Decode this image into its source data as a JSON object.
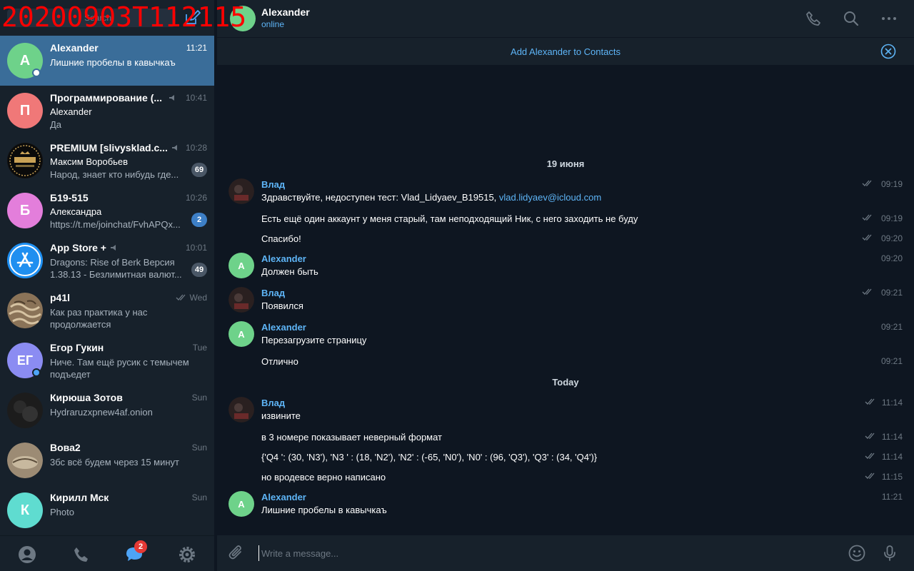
{
  "watermark": "20200903T112115",
  "search": {
    "placeholder": "Search"
  },
  "chats": [
    {
      "initial": "A",
      "name": "Alexander",
      "time": "11:21",
      "preview": "Лишние пробелы в кавычкаъ",
      "color": "#6ed28a",
      "online": true,
      "active": true
    },
    {
      "initial": "П",
      "name": "Программирование (...",
      "time": "10:41",
      "sender": "Alexander",
      "preview": "Да",
      "color": "#f07878",
      "muted": true
    },
    {
      "initial": "",
      "name": "PREMIUM [slivysklad.c...",
      "time": "10:28",
      "sender": "Максим Воробьев",
      "preview": "Народ, знает кто нибудь где...",
      "badge": "69",
      "muted": true,
      "avatar_image": "premium-logo"
    },
    {
      "initial": "Б",
      "name": "Б19-515",
      "time": "10:26",
      "sender": "Александра",
      "preview": "https://t.me/joinchat/FvhAPQx...",
      "badge": "2",
      "badge_color": "blue",
      "color": "#e37edb"
    },
    {
      "initial": "",
      "name": "App Store +",
      "time": "10:01",
      "preview": "Dragons: Rise of Berk Версия 1.38.13 - Безлимитная валют...",
      "badge": "49",
      "muted": true,
      "avatar_image": "app-store-logo"
    },
    {
      "initial": "",
      "name": "p41l",
      "time": "Wed",
      "preview": "Как раз практика у нас продолжается",
      "read": true,
      "avatar_image": "photo-pasta"
    },
    {
      "initial": "ЕГ",
      "name": "Егор Гукин",
      "time": "Tue",
      "preview": "Ниче. Там ещё русик с темычем подъедет",
      "color": "#8b8cf2",
      "online": true
    },
    {
      "initial": "",
      "name": "Кирюша Зотов",
      "time": "Sun",
      "preview": "Hydraruzxpnew4af.onion",
      "avatar_image": "photo-dark"
    },
    {
      "initial": "",
      "name": "Вова2",
      "time": "Sun",
      "preview": "3бс всё будем через 15 минут",
      "avatar_image": "photo-fish"
    },
    {
      "initial": "К",
      "name": "Кирилл Мск",
      "time": "Sun",
      "preview": "Photo",
      "color": "#5fdcd0"
    }
  ],
  "nav": {
    "badge": "2",
    "icons": [
      "profile-icon",
      "phone-icon",
      "chats-icon",
      "settings-icon"
    ]
  },
  "header": {
    "name": "Alexander",
    "status": "online"
  },
  "contact_bar": {
    "link": "Add Alexander to Contacts"
  },
  "date_separators": [
    "19 июня",
    "Today"
  ],
  "messages": [
    {
      "author": "Влад",
      "text": "Здравствуйте, недоступен тест: Vlad_Lidyaev_B19515, ",
      "link": "vlad.lidyaev@icloud.com",
      "time": "09:19",
      "read": true
    },
    {
      "text": "Есть ещё один аккаунт у меня старый, там неподходящий Ник, с него заходить не буду",
      "time": "09:19",
      "read": true
    },
    {
      "text": "Спасибо!",
      "time": "09:20",
      "read": true
    },
    {
      "author": "Alexander",
      "text": "Должен быть",
      "time": "09:20"
    },
    {
      "author": "Влад",
      "text": "Появился",
      "time": "09:21",
      "read": true
    },
    {
      "author": "Alexander",
      "text": "Перезагрузите страницу",
      "time": "09:21"
    },
    {
      "text": "Отлично",
      "time": "09:21"
    },
    {
      "author": "Влад",
      "text": "извините",
      "time": "11:14",
      "read": true
    },
    {
      "text": "в 3 номере показывает неверный формат",
      "time": "11:14",
      "read": true
    },
    {
      "text": "{'Q4 ': (30, 'N3'), 'N3 ' : (18, 'N2'), 'N2' : (-65, 'N0'), 'N0' : (96, 'Q3'), 'Q3' : (34, 'Q4')}",
      "time": "11:14",
      "read": true
    },
    {
      "text": "но вродевсе верно написано",
      "time": "11:15",
      "read": true
    },
    {
      "author": "Alexander",
      "text": "Лишние пробелы в кавычкаъ",
      "time": "11:21"
    }
  ],
  "composer": {
    "placeholder": "Write a message..."
  },
  "colors": {
    "accent": "#5eb5f7",
    "active_chat": "#3a6d99",
    "panel_bg": "#0e1621",
    "sidebar_bg": "#17212b"
  }
}
